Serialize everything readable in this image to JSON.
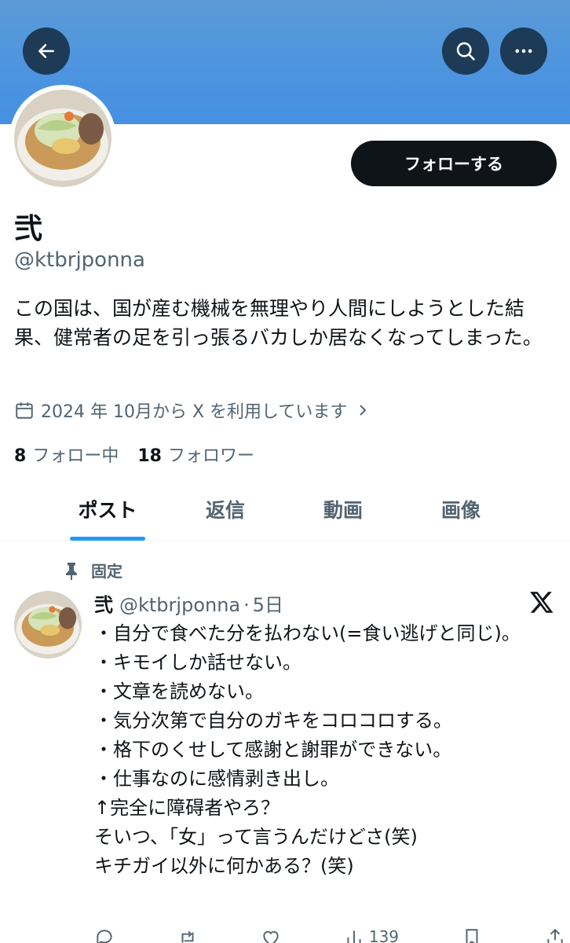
{
  "header": {
    "back_icon": "back-arrow-icon",
    "search_icon": "search-icon",
    "more_icon": "more-horizontal-icon",
    "banner_color": "#4c94e0"
  },
  "profile": {
    "display_name": "弐",
    "handle": "@ktbrjponna",
    "follow_label": "フォローする",
    "bio": "この国は、国が産む機械を無理やり人間にしようとした結果、健常者の足を引っ張るバカしか居なくなってしまった。",
    "joined": "2024 年 10月から X を利用しています",
    "following_count": "8",
    "following_label": "フォロー中",
    "followers_count": "18",
    "followers_label": "フォロワー"
  },
  "tabs": [
    {
      "label": "ポスト",
      "active": true
    },
    {
      "label": "返信",
      "active": false
    },
    {
      "label": "動画",
      "active": false
    },
    {
      "label": "画像",
      "active": false
    }
  ],
  "pinned_post": {
    "pinned_label": "固定",
    "author_name": "弐",
    "author_handle": "@ktbrjponna",
    "separator": "·",
    "time": "5日",
    "lines": [
      "・自分で食べた分を払わない(=食い逃げと同じ)。",
      "・キモイしか話せない。",
      "・文章を読めない。",
      "・気分次第で自分のガキをコロコロする。",
      "・格下のくせして感謝と謝罪ができない。",
      "・仕事なのに感情剥き出し。",
      "↑完全に障碍者やろ？",
      "そいつ、「女」って言うんだけどさ(笑)",
      "キチガイ以外に何かある？(笑)"
    ],
    "views": "139"
  },
  "colors": {
    "accent": "#1d9bf0",
    "text_primary": "#0f1419",
    "text_secondary": "#536471"
  }
}
